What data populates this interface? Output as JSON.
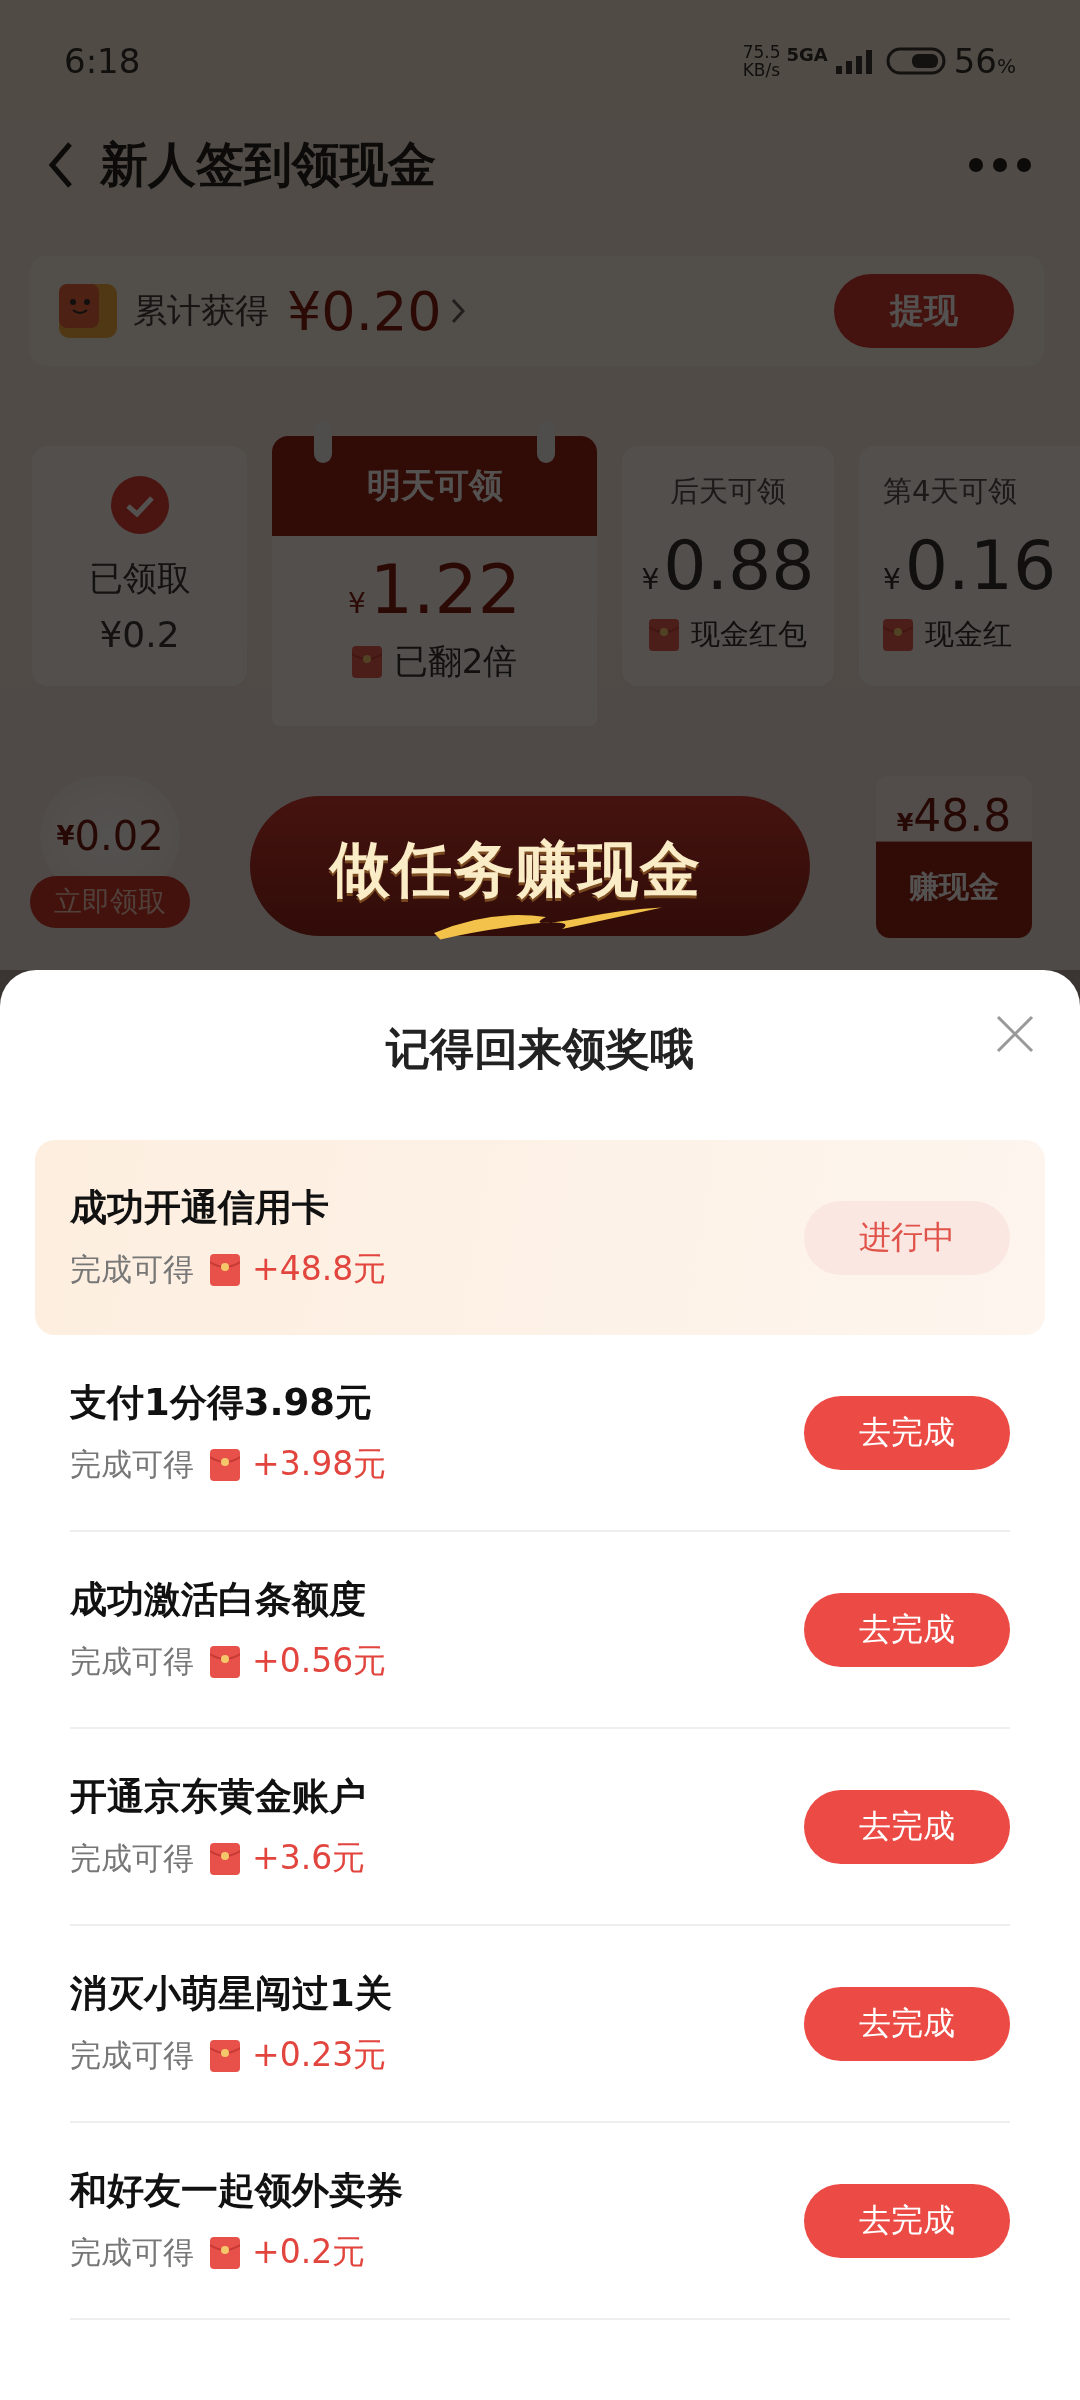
{
  "status_bar": {
    "time": "6:18",
    "speed_value": "75.5",
    "speed_unit": "KB/s",
    "network": "5GA",
    "battery": "56",
    "battery_unit": "%"
  },
  "header": {
    "title": "新人签到领现金"
  },
  "earnings": {
    "label": "累计获得",
    "amount": "¥0.20",
    "button": "提现"
  },
  "days": [
    {
      "kind": "claimed",
      "status": "已领取",
      "amount": "¥0.2"
    },
    {
      "kind": "tomorrow",
      "label": "明天可领",
      "currency": "¥",
      "amount": "1.22",
      "note": "已翻2倍"
    },
    {
      "kind": "future",
      "label": "后天可领",
      "currency": "¥",
      "amount": "0.88",
      "note": "现金红包"
    },
    {
      "kind": "future",
      "label": "第4天可领",
      "currency": "¥",
      "amount": "0.16",
      "note": "现金红"
    }
  ],
  "promo": {
    "bubble_currency": "¥",
    "bubble_amount": "0.02",
    "bubble_button": "立即领取",
    "banner": "做任务赚现金",
    "card_currency": "¥",
    "card_amount": "48.8",
    "card_label": "赚现金"
  },
  "sheet": {
    "title": "记得回来领奖哦",
    "tasks": [
      {
        "title": "成功开通信用卡",
        "reward_label": "完成可得",
        "reward": "+48.8元",
        "button": "进行中",
        "in_progress": true
      },
      {
        "title": "支付1分得3.98元",
        "reward_label": "完成可得",
        "reward": "+3.98元",
        "button": "去完成",
        "in_progress": false
      },
      {
        "title": "成功激活白条额度",
        "reward_label": "完成可得",
        "reward": "+0.56元",
        "button": "去完成",
        "in_progress": false
      },
      {
        "title": "开通京东黄金账户",
        "reward_label": "完成可得",
        "reward": "+3.6元",
        "button": "去完成",
        "in_progress": false
      },
      {
        "title": "消灭小萌星闯过1关",
        "reward_label": "完成可得",
        "reward": "+0.23元",
        "button": "去完成",
        "in_progress": false
      },
      {
        "title": "和好友一起领外卖券",
        "reward_label": "完成可得",
        "reward": "+0.2元",
        "button": "去完成",
        "in_progress": false
      }
    ]
  }
}
